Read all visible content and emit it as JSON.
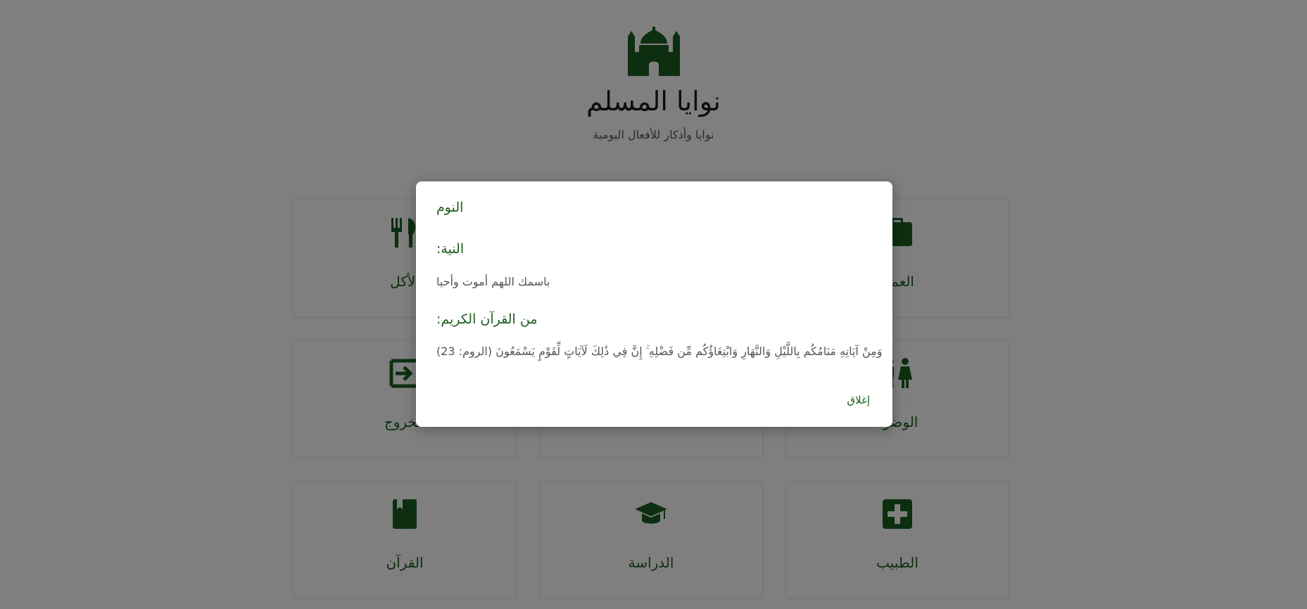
{
  "header": {
    "title": "نوايا المسلم",
    "subtitle": "نوايا وأذكار للأفعال اليومية",
    "logo_icon": "mosque-icon"
  },
  "cards": [
    {
      "label": "الأكل",
      "icon": "utensils-icon"
    },
    {
      "label": "",
      "icon": ""
    },
    {
      "label": "العمل",
      "icon": "briefcase-icon"
    },
    {
      "label": "الخروج",
      "icon": "sign-out-icon"
    },
    {
      "label": "",
      "icon": ""
    },
    {
      "label": "الوضوء",
      "icon": "restroom-icon"
    },
    {
      "label": "القرآن",
      "icon": "book-icon"
    },
    {
      "label": "الدراسة",
      "icon": "graduation-cap-icon"
    },
    {
      "label": "الطبيب",
      "icon": "medical-plus-icon"
    }
  ],
  "modal": {
    "title": "النوم",
    "intention_heading": "النية:",
    "intention_text": "باسمك اللهم أموت وأحيا",
    "quran_heading": "من القرآن الكريم:",
    "quran_text": "وَمِنْ آيَاتِهِ مَنَامُكُم بِاللَّيْلِ وَالنَّهَارِ وَابْتِغَاؤُكُم مِّن فَضْلِهِ ۚ إِنَّ فِي ذَٰلِكَ لَآيَاتٍ لِّقَوْمٍ يَسْمَعُونَ (الروم: 23)",
    "close_label": "إغلاق"
  },
  "colors": {
    "accent": "#1b5e20",
    "overlay": "rgba(0,0,0,0.5)"
  }
}
